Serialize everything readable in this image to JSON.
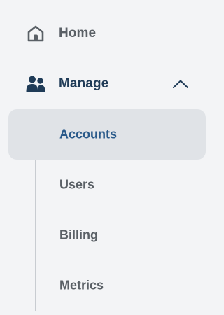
{
  "nav": {
    "home": {
      "label": "Home",
      "icon": "home-icon"
    },
    "manage": {
      "label": "Manage",
      "icon": "users-icon",
      "expanded": true,
      "toggle_icon": "chevron-up-icon",
      "items": [
        {
          "label": "Accounts",
          "active": true
        },
        {
          "label": "Users",
          "active": false
        },
        {
          "label": "Billing",
          "active": false
        },
        {
          "label": "Metrics",
          "active": false
        }
      ]
    }
  },
  "colors": {
    "background": "#f3f4f6",
    "active_bg": "#e0e3e7",
    "active_text": "#2a5a8a",
    "section_text": "#1f3b57",
    "text": "#5a6066",
    "divider": "#c8ccd1"
  }
}
